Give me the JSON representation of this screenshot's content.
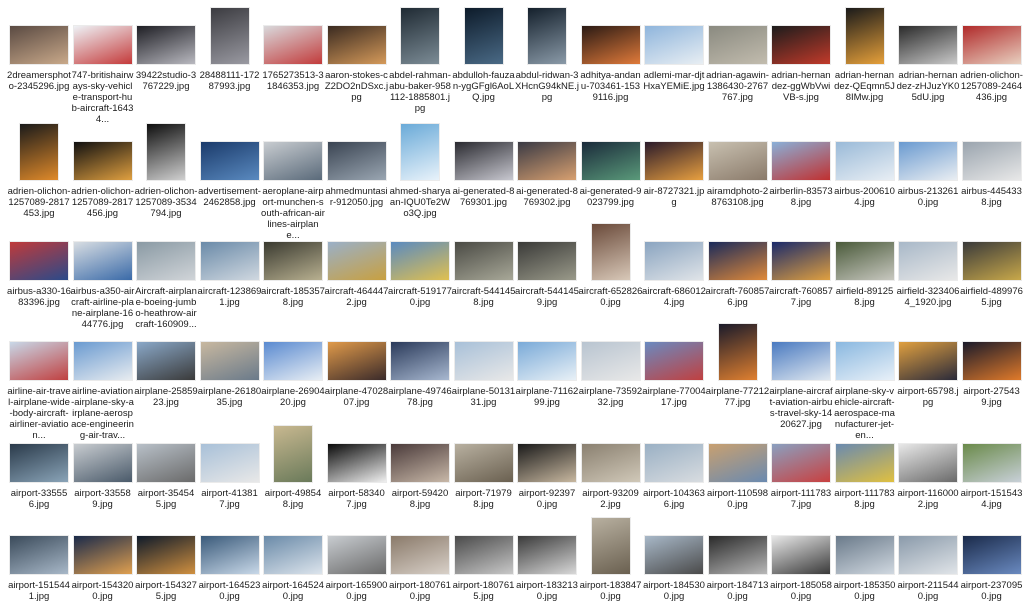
{
  "files": [
    {
      "label": "2dreamersphoto-2345296.jpg",
      "orientation": "landscape",
      "colors": [
        "#5a4a42",
        "#c9a98a"
      ]
    },
    {
      "label": "747-britishairways-sky-vehicle-transport-hub-aircraft-16434...",
      "orientation": "landscape",
      "colors": [
        "#eef2f6",
        "#c43a3a"
      ]
    },
    {
      "label": "39422studio-3767229.jpg",
      "orientation": "landscape",
      "colors": [
        "#1e1e24",
        "#b9b9c0"
      ]
    },
    {
      "label": "28488111-17287993.jpg",
      "orientation": "portrait",
      "colors": [
        "#3b3b40",
        "#9a9aa2"
      ]
    },
    {
      "label": "1765273513-31846353.jpg",
      "orientation": "landscape",
      "colors": [
        "#d9d9dc",
        "#c23b3b"
      ]
    },
    {
      "label": "aaron-stokes-cZ2DO2nDSxc.jpg",
      "orientation": "landscape",
      "colors": [
        "#3a2a20",
        "#d59a5a"
      ]
    },
    {
      "label": "abdel-rahman-abu-baker-958112-1885801.jpg",
      "orientation": "portrait",
      "colors": [
        "#1f2a33",
        "#7c8c96"
      ]
    },
    {
      "label": "abdulloh-fauzan-ygGFgl6AoLQ.jpg",
      "orientation": "portrait",
      "colors": [
        "#0d1b2a",
        "#4a6a86"
      ]
    },
    {
      "label": "abdul-ridwan-3XHcnG94kNE.jpg",
      "orientation": "portrait",
      "colors": [
        "#14202c",
        "#8a9aa8"
      ]
    },
    {
      "label": "adhitya-andanu-703461-1539116.jpg",
      "orientation": "landscape",
      "colors": [
        "#2a1a14",
        "#e07a3a"
      ]
    },
    {
      "label": "adlemi-mar-djtHxaYEMiE.jpg",
      "orientation": "landscape",
      "colors": [
        "#8fb5dc",
        "#e8eef3"
      ]
    },
    {
      "label": "adrian-agawin-1386430-2767767.jpg",
      "orientation": "landscape",
      "colors": [
        "#8a8a80",
        "#c2bcae"
      ]
    },
    {
      "label": "adrian-hernandez-ggWbVwiVB-s.jpg",
      "orientation": "landscape",
      "colors": [
        "#1c1c1c",
        "#c23a2a"
      ]
    },
    {
      "label": "adrian-hernandez-QEqmn5J8IMw.jpg",
      "orientation": "portrait",
      "colors": [
        "#1a1a1a",
        "#e6a03a"
      ]
    },
    {
      "label": "adrian-hernandez-zHJuzYK05dU.jpg",
      "orientation": "landscape",
      "colors": [
        "#2a2a2a",
        "#c9c9c9"
      ]
    },
    {
      "label": "adrien-olichon-1257089-2464436.jpg",
      "orientation": "landscape",
      "colors": [
        "#b02a2a",
        "#e8d0c0"
      ]
    },
    {
      "label": "adrien-olichon-1257089-2817453.jpg",
      "orientation": "portrait",
      "colors": [
        "#1a1a1a",
        "#e08a2a"
      ]
    },
    {
      "label": "adrien-olichon-1257089-2817456.jpg",
      "orientation": "landscape",
      "colors": [
        "#101010",
        "#e0a040"
      ]
    },
    {
      "label": "adrien-olichon-1257089-3534794.jpg",
      "orientation": "portrait",
      "colors": [
        "#0e0e0e",
        "#d0d0d0"
      ]
    },
    {
      "label": "advertisement-2462858.jpg",
      "orientation": "landscape",
      "colors": [
        "#1a3a6a",
        "#5a8ac0"
      ]
    },
    {
      "label": "aeroplane-airport-munchen-south-african-airlines-airplane...",
      "orientation": "landscape",
      "colors": [
        "#c8ccd0",
        "#5a6a7a"
      ]
    },
    {
      "label": "ahmedmuntasir-912050.jpg",
      "orientation": "landscape",
      "colors": [
        "#3a4452",
        "#9aa6b2"
      ]
    },
    {
      "label": "ahmed-sharyaan-IQU0Te2Wo3Q.jpg",
      "orientation": "portrait",
      "colors": [
        "#6aaad8",
        "#e8f2fa"
      ]
    },
    {
      "label": "ai-generated-8769301.jpg",
      "orientation": "landscape",
      "colors": [
        "#2a2a30",
        "#c8c8d0"
      ]
    },
    {
      "label": "ai-generated-8769302.jpg",
      "orientation": "landscape",
      "colors": [
        "#3a3a44",
        "#d8a070"
      ]
    },
    {
      "label": "ai-generated-9023799.jpg",
      "orientation": "landscape",
      "colors": [
        "#1a2a3a",
        "#5a9a7a"
      ]
    },
    {
      "label": "air-8727321.jpg",
      "orientation": "landscape",
      "colors": [
        "#2a1a2a",
        "#e8a040"
      ]
    },
    {
      "label": "airamdphoto-28763108.jpg",
      "orientation": "landscape",
      "colors": [
        "#c8c0b0",
        "#8a7a6a"
      ]
    },
    {
      "label": "airberlin-835738.jpg",
      "orientation": "landscape",
      "colors": [
        "#8ab0d8",
        "#c03030"
      ]
    },
    {
      "label": "airbus-2006104.jpg",
      "orientation": "landscape",
      "colors": [
        "#9abad8",
        "#e8eef4"
      ]
    },
    {
      "label": "airbus-2132610.jpg",
      "orientation": "landscape",
      "colors": [
        "#6a9ad0",
        "#eaeef2"
      ]
    },
    {
      "label": "airbus-4454338.jpg",
      "orientation": "landscape",
      "colors": [
        "#9aa4ae",
        "#e8e8e8"
      ]
    },
    {
      "label": "airbus-a330-1683396.jpg",
      "orientation": "landscape",
      "colors": [
        "#c03a3a",
        "#2a4a8a"
      ]
    },
    {
      "label": "airbus-a350-aircraft-airline-plane-airplane-1644776.jpg",
      "orientation": "landscape",
      "colors": [
        "#d8dde2",
        "#3a6aa8"
      ]
    },
    {
      "label": "Aircraft-airplane-boeing-jumbo-heathrow-aircraft-160909...",
      "orientation": "landscape",
      "colors": [
        "#8a9aa4",
        "#d0d4d8"
      ]
    },
    {
      "label": "aircraft-1238691.jpg",
      "orientation": "landscape",
      "colors": [
        "#6a8aa8",
        "#d0d8e0"
      ]
    },
    {
      "label": "aircraft-1853578.jpg",
      "orientation": "landscape",
      "colors": [
        "#3a3a30",
        "#b8b090"
      ]
    },
    {
      "label": "aircraft-4644472.jpg",
      "orientation": "landscape",
      "colors": [
        "#9ab0c8",
        "#c8a040"
      ]
    },
    {
      "label": "aircraft-5191770.jpg",
      "orientation": "landscape",
      "colors": [
        "#5a8ac0",
        "#e0c050"
      ]
    },
    {
      "label": "aircraft-5441458.jpg",
      "orientation": "landscape",
      "colors": [
        "#4a4a44",
        "#a8a898"
      ]
    },
    {
      "label": "aircraft-5441459.jpg",
      "orientation": "landscape",
      "colors": [
        "#3a3a38",
        "#9a9a8a"
      ]
    },
    {
      "label": "aircraft-6528260.jpg",
      "orientation": "portrait",
      "colors": [
        "#6a4a3a",
        "#d8c8b8"
      ]
    },
    {
      "label": "aircraft-6860124.jpg",
      "orientation": "landscape",
      "colors": [
        "#8aa4c0",
        "#e0e4e8"
      ]
    },
    {
      "label": "aircraft-7608576.jpg",
      "orientation": "landscape",
      "colors": [
        "#1a2a5a",
        "#e08a3a"
      ]
    },
    {
      "label": "aircraft-7608577.jpg",
      "orientation": "landscape",
      "colors": [
        "#1a2a6a",
        "#e0a040"
      ]
    },
    {
      "label": "airfield-891258.jpg",
      "orientation": "landscape",
      "colors": [
        "#4a5a3a",
        "#c8c8c0"
      ]
    },
    {
      "label": "airfield-3234064_1920.jpg",
      "orientation": "landscape",
      "colors": [
        "#a8b8c8",
        "#e8e8e8"
      ]
    },
    {
      "label": "airfield-4899765.jpg",
      "orientation": "landscape",
      "colors": [
        "#3a3a3a",
        "#c8a84a"
      ]
    },
    {
      "label": "airline-air-travel-airplane-wide-body-aircraft-airliner-aviation...",
      "orientation": "landscape",
      "colors": [
        "#c8d8e8",
        "#c04040"
      ]
    },
    {
      "label": "airline-aviation-airplane-sky-airplane-aerospace-engineering-air-trav...",
      "orientation": "landscape",
      "colors": [
        "#6a9ad0",
        "#e8ecf0"
      ]
    },
    {
      "label": "airplane-2585923.jpg",
      "orientation": "landscape",
      "colors": [
        "#8aa8c8",
        "#3a3a3a"
      ]
    },
    {
      "label": "airplane-2618035.jpg",
      "orientation": "landscape",
      "colors": [
        "#c8b8a0",
        "#6a7a8a"
      ]
    },
    {
      "label": "airplane-2690420.jpg",
      "orientation": "landscape",
      "colors": [
        "#5a8ad0",
        "#e8eef4"
      ]
    },
    {
      "label": "airplane-4702807.jpg",
      "orientation": "landscape",
      "colors": [
        "#e09a4a",
        "#3a2a2a"
      ]
    },
    {
      "label": "airplane-4974678.jpg",
      "orientation": "landscape",
      "colors": [
        "#2a3a5a",
        "#a8b8d0"
      ]
    },
    {
      "label": "airplane-5013131.jpg",
      "orientation": "landscape",
      "colors": [
        "#a8c0d8",
        "#e8e8e8"
      ]
    },
    {
      "label": "airplane-7116299.jpg",
      "orientation": "landscape",
      "colors": [
        "#7aaad8",
        "#e8f0f6"
      ]
    },
    {
      "label": "airplane-7359232.jpg",
      "orientation": "landscape",
      "colors": [
        "#b8c4d0",
        "#e8e8e8"
      ]
    },
    {
      "label": "airplane-7700417.jpg",
      "orientation": "landscape",
      "colors": [
        "#6a8ac0",
        "#c04040"
      ]
    },
    {
      "label": "airplane-7721277.jpg",
      "orientation": "portrait",
      "colors": [
        "#1a1a2a",
        "#e08030"
      ]
    },
    {
      "label": "airplane-aircraft-aviation-airbus-travel-sky-1420627.jpg",
      "orientation": "landscape",
      "colors": [
        "#4a7ac0",
        "#e0e8f0"
      ]
    },
    {
      "label": "airplane-sky-vehicle-aircraft-aerospace-manufacturer-jet-en...",
      "orientation": "landscape",
      "colors": [
        "#8ab8e0",
        "#e8f0f8"
      ]
    },
    {
      "label": "airport-65798.jpg",
      "orientation": "landscape",
      "colors": [
        "#e0a040",
        "#2a2a3a"
      ]
    },
    {
      "label": "airport-275439.jpg",
      "orientation": "landscape",
      "colors": [
        "#1a1a2a",
        "#e07a2a"
      ]
    },
    {
      "label": "airport-335556.jpg",
      "orientation": "landscape",
      "colors": [
        "#2a3a4a",
        "#8aa4b8"
      ]
    },
    {
      "label": "airport-335589.jpg",
      "orientation": "landscape",
      "colors": [
        "#c8ccd0",
        "#4a5a6a"
      ]
    },
    {
      "label": "airport-354545.jpg",
      "orientation": "landscape",
      "colors": [
        "#b8c0c8",
        "#6a6a6a"
      ]
    },
    {
      "label": "airport-413817.jpg",
      "orientation": "landscape",
      "colors": [
        "#a8c0d8",
        "#e8e8e8"
      ]
    },
    {
      "label": "airport-498548.jpg",
      "orientation": "portrait",
      "colors": [
        "#c8b890",
        "#6a7a5a"
      ]
    },
    {
      "label": "airport-583407.jpg",
      "orientation": "landscape",
      "colors": [
        "#0a0a0a",
        "#f0f0f0"
      ]
    },
    {
      "label": "airport-594208.jpg",
      "orientation": "landscape",
      "colors": [
        "#4a3a3a",
        "#c8b8a8"
      ]
    },
    {
      "label": "airport-719798.jpg",
      "orientation": "landscape",
      "colors": [
        "#b8b0a0",
        "#6a6050"
      ]
    },
    {
      "label": "airport-923970.jpg",
      "orientation": "landscape",
      "colors": [
        "#1a1a1a",
        "#c8b8a0"
      ]
    },
    {
      "label": "airport-932092.jpg",
      "orientation": "landscape",
      "colors": [
        "#8a8070",
        "#d0c8b8"
      ]
    },
    {
      "label": "airport-1043636.jpg",
      "orientation": "landscape",
      "colors": [
        "#9ab0c4",
        "#d8dce0"
      ]
    },
    {
      "label": "airport-1105980.jpg",
      "orientation": "landscape",
      "colors": [
        "#c8a070",
        "#6a8ab0"
      ]
    },
    {
      "label": "airport-1117837.jpg",
      "orientation": "landscape",
      "colors": [
        "#8aa0c0",
        "#c84040"
      ]
    },
    {
      "label": "airport-1117838.jpg",
      "orientation": "landscape",
      "colors": [
        "#6a8ab0",
        "#e0c040"
      ]
    },
    {
      "label": "airport-1160002.jpg",
      "orientation": "landscape",
      "colors": [
        "#e8e8e8",
        "#6a6a6a"
      ]
    },
    {
      "label": "airport-1515434.jpg",
      "orientation": "landscape",
      "colors": [
        "#6a8a4a",
        "#c8d0d8"
      ]
    },
    {
      "label": "airport-1515441.jpg",
      "orientation": "landscape",
      "colors": [
        "#3a4a5a",
        "#a8b8c8"
      ]
    },
    {
      "label": "airport-1543200.jpg",
      "orientation": "landscape",
      "colors": [
        "#1a2a4a",
        "#e0a050"
      ]
    },
    {
      "label": "airport-1543275.jpg",
      "orientation": "landscape",
      "colors": [
        "#0e1a2a",
        "#d09040"
      ]
    },
    {
      "label": "airport-1645230.jpg",
      "orientation": "landscape",
      "colors": [
        "#3a5a7a",
        "#c8d8e8"
      ]
    },
    {
      "label": "airport-1645240.jpg",
      "orientation": "landscape",
      "colors": [
        "#6a8aa8",
        "#dce4ec"
      ]
    },
    {
      "label": "airport-1659000.jpg",
      "orientation": "landscape",
      "colors": [
        "#c8ccd0",
        "#6a6a6a"
      ]
    },
    {
      "label": "airport-1807610.jpg",
      "orientation": "landscape",
      "colors": [
        "#8a7a6a",
        "#d8d0c8"
      ]
    },
    {
      "label": "airport-1807615.jpg",
      "orientation": "landscape",
      "colors": [
        "#4a4a4a",
        "#c8c8c8"
      ]
    },
    {
      "label": "airport-1832130.jpg",
      "orientation": "landscape",
      "colors": [
        "#3a3a3a",
        "#d8d8d8"
      ]
    },
    {
      "label": "airport-1838470.jpg",
      "orientation": "portrait",
      "colors": [
        "#b8b0a0",
        "#6a6050"
      ]
    },
    {
      "label": "airport-1845300.jpg",
      "orientation": "landscape",
      "colors": [
        "#a8b8c8",
        "#4a4a4a"
      ]
    },
    {
      "label": "airport-1847130.jpg",
      "orientation": "landscape",
      "colors": [
        "#2a2a2a",
        "#b8b8b8"
      ]
    },
    {
      "label": "airport-1850580.jpg",
      "orientation": "landscape",
      "colors": [
        "#e8e8e8",
        "#3a3a3a"
      ]
    },
    {
      "label": "airport-1853500.jpg",
      "orientation": "landscape",
      "colors": [
        "#6a7a8a",
        "#d0d8e0"
      ]
    },
    {
      "label": "airport-2115440.jpg",
      "orientation": "landscape",
      "colors": [
        "#8a9aaa",
        "#e0e4e8"
      ]
    },
    {
      "label": "airport-2370950.jpg",
      "orientation": "landscape",
      "colors": [
        "#1a2a4a",
        "#6a8ac0"
      ]
    }
  ]
}
